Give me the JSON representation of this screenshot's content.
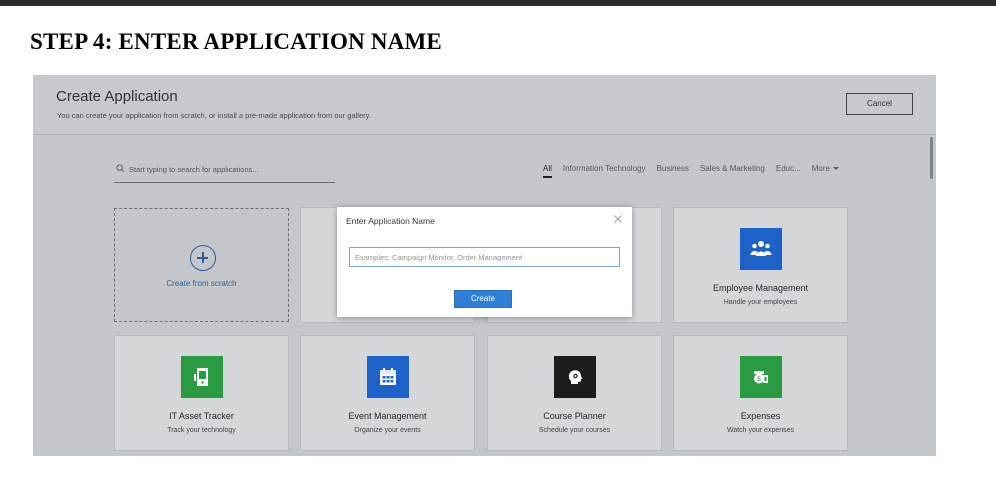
{
  "heading": "STEP 4: ENTER APPLICATION NAME",
  "header": {
    "title": "Create Application",
    "subtitle": "You can create your application from scratch, or install a pre-made application from our gallery.",
    "cancel_label": "Cancel"
  },
  "search": {
    "placeholder": "Start typing to search for applications..."
  },
  "categories": [
    {
      "label": "All",
      "active": true
    },
    {
      "label": "Information Technology",
      "active": false
    },
    {
      "label": "Business",
      "active": false
    },
    {
      "label": "Sales & Marketing",
      "active": false
    },
    {
      "label": "Educ...",
      "active": false
    },
    {
      "label": "More",
      "active": false
    }
  ],
  "scratch_card": {
    "label": "Create from scratch"
  },
  "cards": [
    {
      "title": "Employee Management",
      "subtitle": "Handle your employees",
      "icon": "people-icon",
      "color": "#1d62c9"
    },
    {
      "title": "IT Asset Tracker",
      "subtitle": "Track your technology",
      "icon": "device-icon",
      "color": "#2a9a43"
    },
    {
      "title": "Event Management",
      "subtitle": "Organize your events",
      "icon": "calendar-icon",
      "color": "#1d62c9"
    },
    {
      "title": "Course Planner",
      "subtitle": "Schedule your courses",
      "icon": "lightbulb-head-icon",
      "color": "#1c1c1c"
    },
    {
      "title": "Expenses",
      "subtitle": "Watch your expenses",
      "icon": "wallet-icon",
      "color": "#2a9a43"
    }
  ],
  "modal": {
    "title": "Enter Application Name",
    "input_placeholder": "Examples: Campaign Monitor, Order Management",
    "create_label": "Create"
  }
}
